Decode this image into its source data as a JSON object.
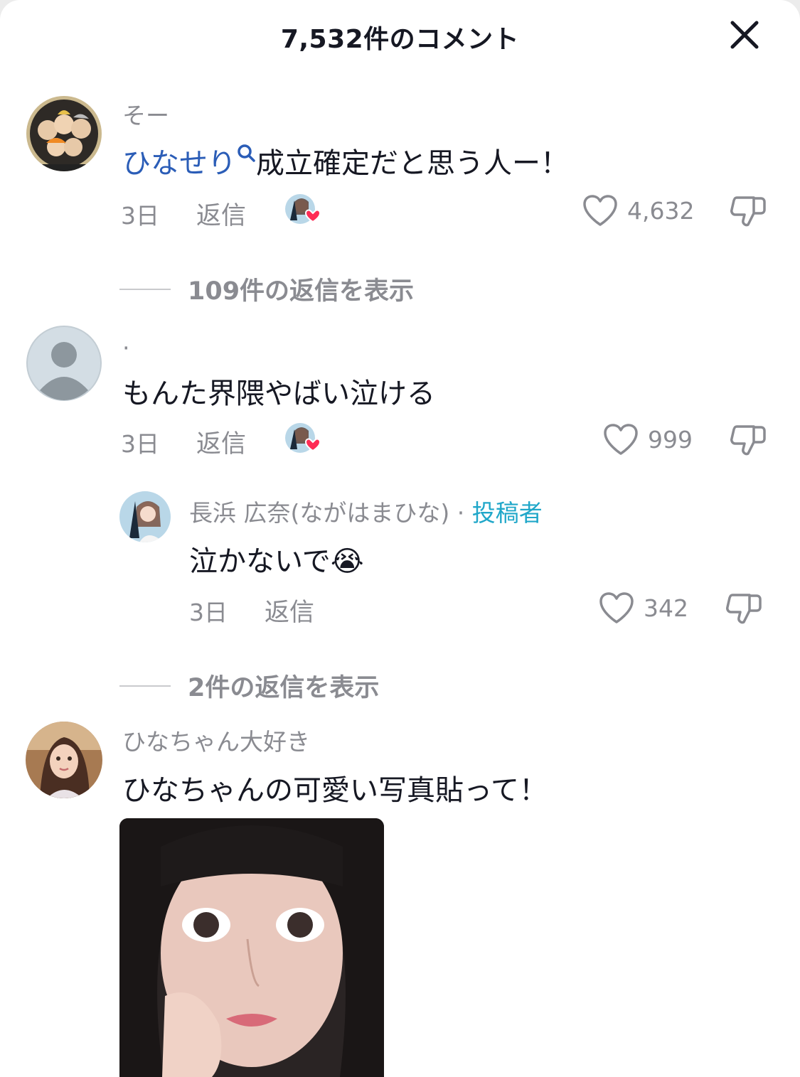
{
  "header": {
    "title": "7,532件のコメント",
    "close_icon": "close-icon"
  },
  "comments": [
    {
      "username": "そー",
      "mention": "ひなせり",
      "text": "成立確定だと思う人ー！",
      "time": "3日",
      "reply_label": "返信",
      "likes": "4,632",
      "creator_liked": true
    },
    {
      "username": "·",
      "text": "もんた界隈やばい泣ける",
      "time": "3日",
      "reply_label": "返信",
      "likes": "999",
      "creator_liked": true,
      "reply": {
        "username": "長浜 広奈(ながはまひな)",
        "separator": "·",
        "creator_label": "投稿者",
        "text": "泣かないで",
        "emoji": "😭",
        "time": "3日",
        "reply_label": "返信",
        "likes": "342"
      }
    },
    {
      "username": "ひなちゃん大好き",
      "text": "ひなちゃんの可愛い写真貼って！"
    }
  ],
  "view_replies": [
    "109件の返信を表示",
    "2件の返信を表示"
  ],
  "colors": {
    "text": "#161823",
    "secondary": "#8a8b91",
    "mention": "#2b5db7",
    "creator": "#20a7c9",
    "heart": "#fe2c55"
  }
}
